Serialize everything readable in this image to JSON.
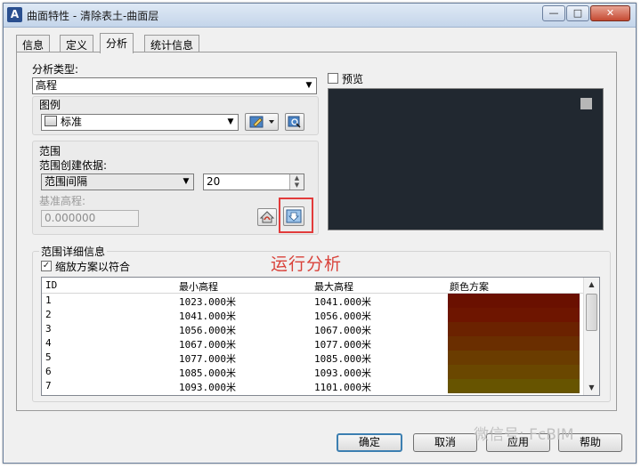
{
  "window": {
    "title": "曲面特性 - 清除表土-曲面层"
  },
  "tabs": [
    {
      "label": "信息"
    },
    {
      "label": "定义"
    },
    {
      "label": "分析"
    },
    {
      "label": "统计信息"
    }
  ],
  "analysis": {
    "type_label": "分析类型:",
    "type_value": "高程",
    "legend_group": "图例",
    "legend_value": "标准"
  },
  "range": {
    "group_label": "范围",
    "creation_label": "范围创建依据:",
    "creation_value": "范围间隔",
    "interval_value": "20",
    "base_elev_label": "基准高程:",
    "base_elev_value": "0.000000"
  },
  "preview": {
    "label": "预览"
  },
  "details": {
    "group_label": "范围详细信息",
    "fit_label": "缩放方案以符合",
    "columns": [
      "ID",
      "最小高程",
      "最大高程",
      "颜色方案"
    ],
    "rows": [
      {
        "id": "1",
        "min": "1023.000米",
        "max": "1041.000米",
        "color": "#6a1000"
      },
      {
        "id": "2",
        "min": "1041.000米",
        "max": "1056.000米",
        "color": "#6e1500"
      },
      {
        "id": "3",
        "min": "1056.000米",
        "max": "1067.000米",
        "color": "#6b2200"
      },
      {
        "id": "4",
        "min": "1067.000米",
        "max": "1077.000米",
        "color": "#6a2e00"
      },
      {
        "id": "5",
        "min": "1077.000米",
        "max": "1085.000米",
        "color": "#6a3c00"
      },
      {
        "id": "6",
        "min": "1085.000米",
        "max": "1093.000米",
        "color": "#6a4700"
      },
      {
        "id": "7",
        "min": "1093.000米",
        "max": "1101.000米",
        "color": "#675400"
      }
    ]
  },
  "annotation": "运行分析",
  "watermark": "微信号: FcBIM",
  "buttons": {
    "ok": "确定",
    "cancel": "取消",
    "apply": "应用",
    "help": "帮助"
  }
}
